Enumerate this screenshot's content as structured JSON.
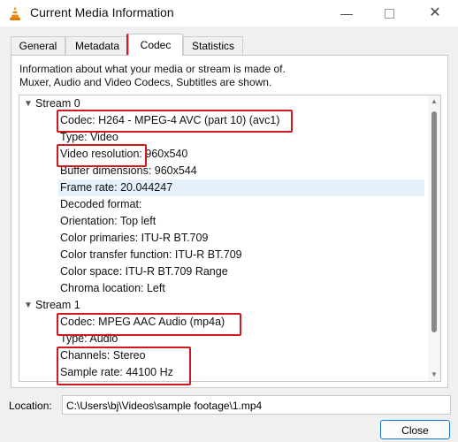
{
  "window": {
    "title": "Current Media Information",
    "close_glyph": "✕",
    "min_glyph": "—"
  },
  "tabs": [
    {
      "label": "General",
      "key": "G"
    },
    {
      "label": "Metadata",
      "key": "M"
    },
    {
      "label": "Codec",
      "key": "C"
    },
    {
      "label": "Statistics",
      "key": "S"
    }
  ],
  "active_tab": "Codec",
  "info": {
    "line1": "Information about what your media or stream is made of.",
    "line2": "Muxer, Audio and Video Codecs, Subtitles are shown."
  },
  "tree": {
    "stream0": {
      "label": "Stream 0",
      "items": [
        "Codec: H264 - MPEG-4 AVC (part 10) (avc1)",
        "Type: Video",
        "Video resolution: 960x540",
        "Buffer dimensions: 960x544",
        "Frame rate: 20.044247",
        "Decoded format:",
        "Orientation: Top left",
        "Color primaries: ITU-R BT.709",
        "Color transfer function: ITU-R BT.709",
        "Color space: ITU-R BT.709 Range",
        "Chroma location: Left"
      ]
    },
    "stream1": {
      "label": "Stream 1",
      "items": [
        "Codec: MPEG AAC Audio (mp4a)",
        "Type: Audio",
        "Channels: Stereo",
        "Sample rate: 44100 Hz"
      ]
    }
  },
  "location": {
    "label": "Location:",
    "value": "C:\\Users\\bj\\Videos\\sample footage\\1.mp4"
  },
  "close_button": "Close",
  "colors": {
    "highlight": "#d0191f",
    "accent": "#1c74c8",
    "selected_row": "#e5f0fb"
  }
}
